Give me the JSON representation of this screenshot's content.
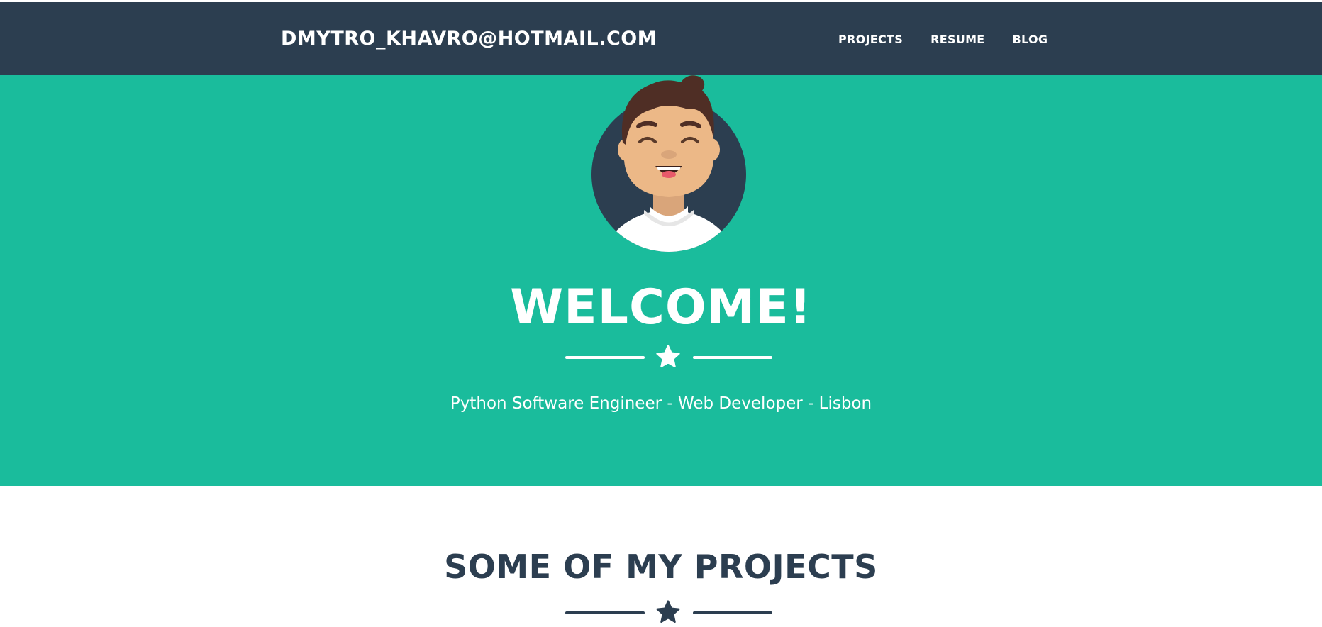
{
  "navbar": {
    "brand": "DMYTRO_KHAVRO@HOTMAIL.COM",
    "links": [
      {
        "label": "PROJECTS"
      },
      {
        "label": "RESUME"
      },
      {
        "label": "BLOG"
      }
    ]
  },
  "hero": {
    "title": "WELCOME!",
    "subtitle": "Python Software Engineer - Web Developer - Lisbon",
    "avatar_icon": "smiling-man-avatar-icon",
    "divider_icon": "star-icon"
  },
  "projects": {
    "title": "SOME OF MY PROJECTS",
    "divider_icon": "star-icon"
  },
  "colors": {
    "navbar_bg": "#2c3e50",
    "hero_bg": "#1abc9c",
    "primary_text": "#2c3e50",
    "light_text": "#ffffff"
  }
}
